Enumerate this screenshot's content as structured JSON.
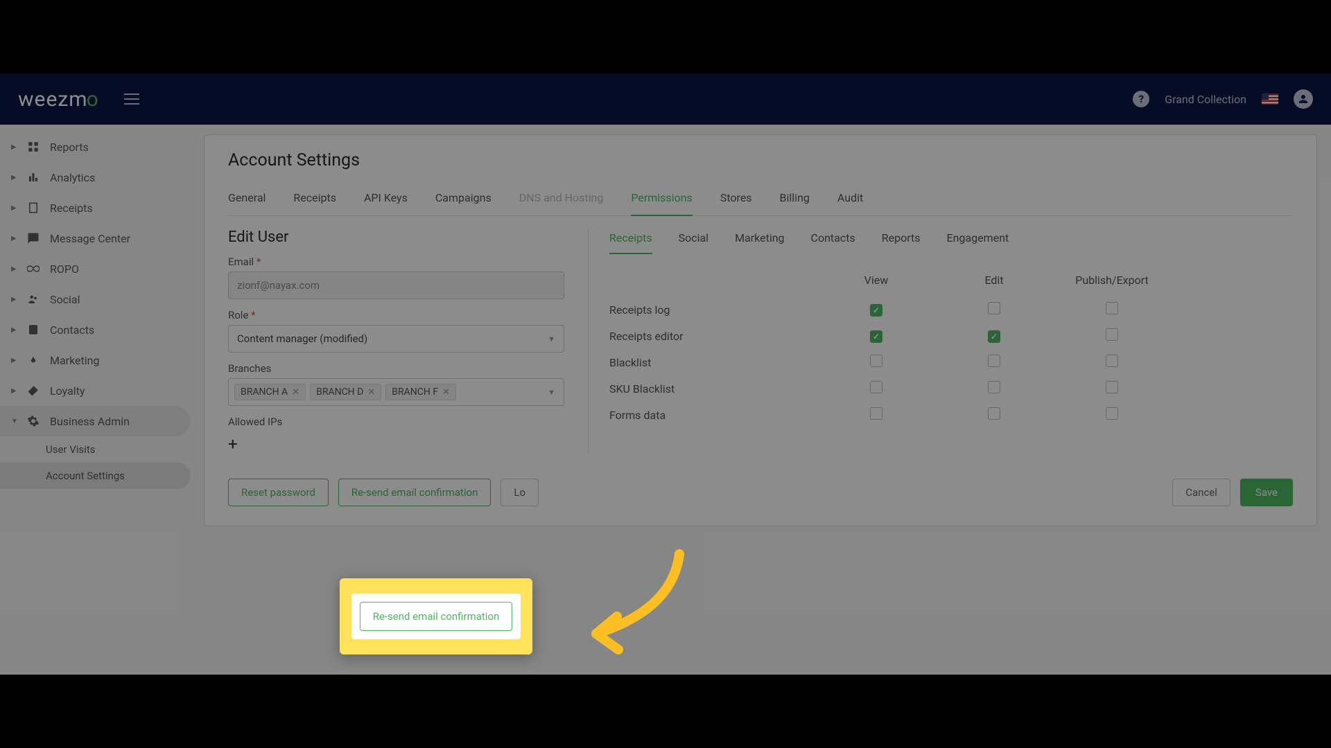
{
  "header": {
    "logo_text": "weezm",
    "logo_accent": "o",
    "org_name": "Grand Collection"
  },
  "sidebar": {
    "items": [
      {
        "label": "Reports"
      },
      {
        "label": "Analytics"
      },
      {
        "label": "Receipts"
      },
      {
        "label": "Message Center"
      },
      {
        "label": "ROPO"
      },
      {
        "label": "Social"
      },
      {
        "label": "Contacts"
      },
      {
        "label": "Marketing"
      },
      {
        "label": "Loyalty"
      },
      {
        "label": "Business Admin"
      }
    ],
    "sub_items": [
      {
        "label": "User Visits"
      },
      {
        "label": "Account Settings"
      }
    ]
  },
  "page": {
    "title": "Account Settings",
    "tabs": [
      "General",
      "Receipts",
      "API Keys",
      "Campaigns",
      "DNS and Hosting",
      "Permissions",
      "Stores",
      "Billing",
      "Audit"
    ],
    "active_tab": "Permissions"
  },
  "form": {
    "section_title": "Edit User",
    "email_label": "Email",
    "email_value": "zionf@nayax.com",
    "role_label": "Role",
    "role_value": "Content manager (modified)",
    "branches_label": "Branches",
    "branches": [
      "BRANCH A",
      "BRANCH D",
      "BRANCH F"
    ],
    "allowed_ips_label": "Allowed IPs",
    "reset_password": "Reset password",
    "resend_email": "Re-send email confirmation",
    "login_btn": "Lo",
    "cancel": "Cancel",
    "save": "Save"
  },
  "permissions": {
    "tabs": [
      "Receipts",
      "Social",
      "Marketing",
      "Contacts",
      "Reports",
      "Engagement"
    ],
    "active_tab": "Receipts",
    "columns": [
      "View",
      "Edit",
      "Publish/Export"
    ],
    "rows": [
      {
        "label": "Receipts log",
        "values": [
          true,
          false,
          false
        ]
      },
      {
        "label": "Receipts editor",
        "values": [
          true,
          true,
          false
        ]
      },
      {
        "label": "Blacklist",
        "values": [
          false,
          false,
          false
        ]
      },
      {
        "label": "SKU Blacklist",
        "values": [
          false,
          false,
          false
        ]
      },
      {
        "label": "Forms data",
        "values": [
          false,
          false,
          false
        ]
      }
    ]
  },
  "highlight": {
    "button_label": "Re-send email confirmation"
  }
}
